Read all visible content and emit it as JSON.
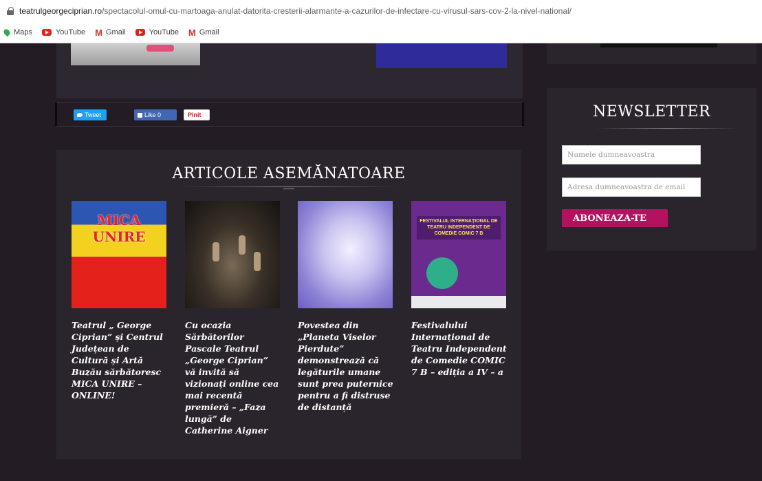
{
  "browser": {
    "url_host": "teatrulgeorgeciprian.ro",
    "url_path": "/spectacolul-omul-cu-martoaga-anulat-datorita-cresterii-alarmante-a-cazurilor-de-infectare-cu-virusul-sars-cov-2-la-nivel-national/",
    "bookmarks": [
      {
        "label": "Maps",
        "icon": "maps-icon"
      },
      {
        "label": "YouTube",
        "icon": "youtube-icon"
      },
      {
        "label": "Gmail",
        "icon": "gmail-icon"
      },
      {
        "label": "YouTube",
        "icon": "youtube-icon"
      },
      {
        "label": "Gmail",
        "icon": "gmail-icon"
      }
    ]
  },
  "share": {
    "tweet_label": "Tweet",
    "like_label": "Like 0",
    "pin_label": "Pinit"
  },
  "related": {
    "title": "ARTICOLE ASEMĂNATOARE",
    "articles": [
      {
        "title": "Teatrul „ George Ciprian” și Centrul Județean de Cultură și Artă Buzău sărbătoresc MICA UNIRE – ONLINE!",
        "thumb_label": "MICA UNIRE"
      },
      {
        "title": "Cu ocazia Sărbătorilor Pascale Teatrul „George Ciprian” vă invită să vizionați online cea mai recentă premieră – „Faza lungă” de Catherine Aigner"
      },
      {
        "title": "Povestea din „Planeta Viselor Pierdute” demonstrează că legăturile umane sunt prea puternice pentru a fi distruse de distanță"
      },
      {
        "title": "Festivalului Internațional de Teatru Independent de Comedie COMIC 7 B – ediția a IV – a",
        "thumb_label": "FESTIVALUL INTERNAȚIONAL DE TEATRU INDEPENDENT DE COMEDIE COMIC 7 B"
      }
    ]
  },
  "newsletter": {
    "title": "NEWSLETTER",
    "name_placeholder": "Numele dumneavoastra",
    "email_placeholder": "Adresa dumneavoastra de email",
    "subscribe_label": "ABONEAZA-TE"
  },
  "colors": {
    "page_bg": "#231c25",
    "panel_bg": "#2a252d",
    "accent": "#b3125f",
    "twitter": "#1da1f2",
    "facebook": "#4267b2"
  }
}
